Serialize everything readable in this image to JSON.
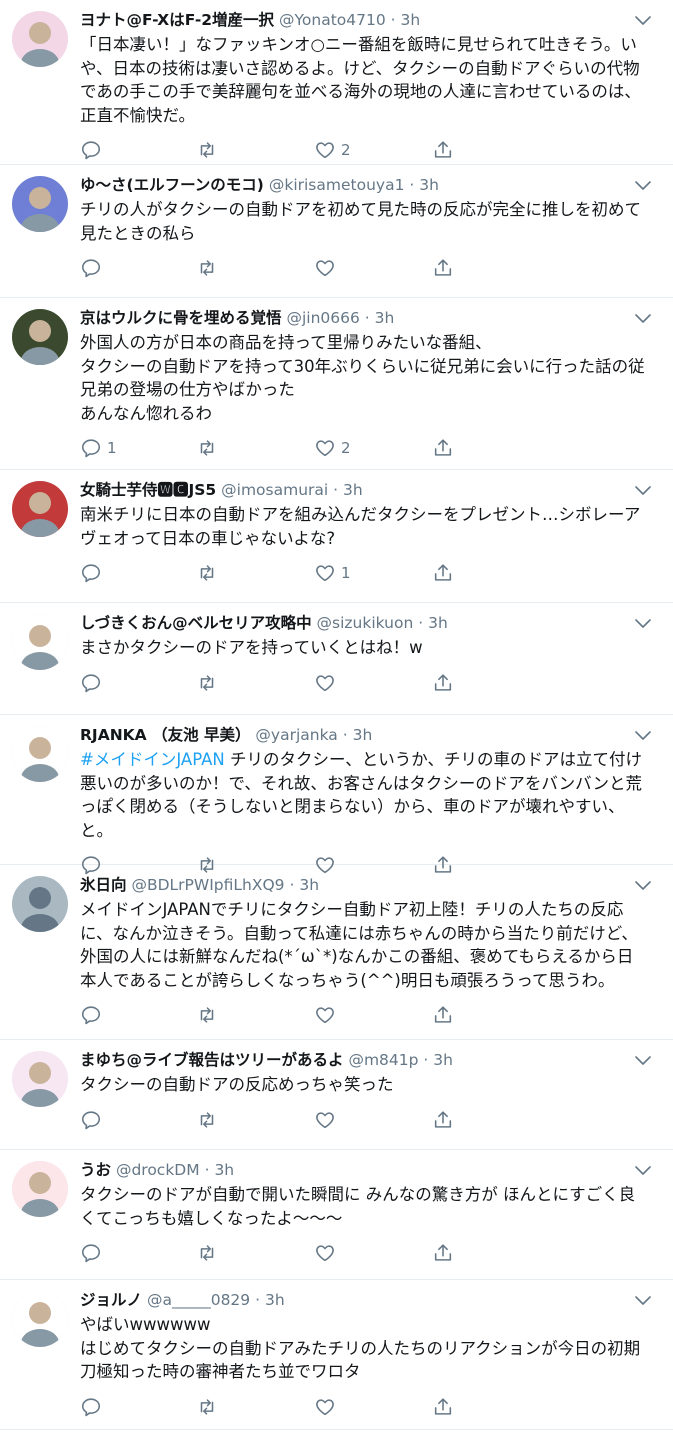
{
  "tweets": [
    {
      "name": "ヨナト@F-XはF-2増産一択",
      "handle": "@Yonato4710",
      "time": "3h",
      "text": "「日本凄い！」なファッキンオ○ニー番組を飯時に見せられて吐きそう。いや、日本の技術は凄いさ認めるよ。けど、タクシーの自動ドアぐらいの代物であの手この手で美辞麗句を並べる海外の現地の人達に言わせているのは、正直不愉快だ。",
      "hashtag": "",
      "reply_count": "",
      "like_count": "2",
      "avatar_color": "#f4d7e6"
    },
    {
      "name": "ゆ〜さ(エルフーンのモコ)",
      "handle": "@kirisametouya1",
      "time": "3h",
      "text": "チリの人がタクシーの自動ドアを初めて見た時の反応が完全に推しを初めて見たときの私ら",
      "hashtag": "",
      "reply_count": "",
      "like_count": "",
      "avatar_color": "#6f7fd6"
    },
    {
      "name": "京はウルクに骨を埋める覚悟",
      "handle": "@jin0666",
      "time": "3h",
      "text": "外国人の方が日本の商品を持って里帰りみたいな番組、\nタクシーの自動ドアを持って30年ぶりくらいに従兄弟に会いに行った話の従兄弟の登場の仕方やばかった\nあんなん惚れるわ",
      "hashtag": "",
      "reply_count": "1",
      "like_count": "2",
      "avatar_color": "#3b4a2e"
    },
    {
      "name": "女騎士芋侍🆆🅲JS5",
      "handle": "@imosamurai",
      "time": "3h",
      "text": "南米チリに日本の自動ドアを組み込んだタクシーをプレゼント…シボレーアヴェオって日本の車じゃないよな?",
      "hashtag": "",
      "reply_count": "",
      "like_count": "1",
      "avatar_color": "#c23a3a"
    },
    {
      "name": "しづきくおん@ベルセリア攻略中",
      "handle": "@sizukikuon",
      "time": "3h",
      "text": "まさかタクシーのドアを持っていくとはね！w",
      "hashtag": "",
      "reply_count": "",
      "like_count": "",
      "avatar_color": "#ffffff"
    },
    {
      "name": "RJANKA （友池 早美）",
      "handle": "@yarjanka",
      "time": "3h",
      "text": " チリのタクシー、というか、チリの車のドアは立て付け悪いのが多いのか！で、それ故、お客さんはタクシーのドアをバンバンと荒っぽく閉める（そうしないと閉まらない）から、車のドアが壊れやすい、と。",
      "hashtag": "#メイドインJAPAN",
      "reply_count": "",
      "like_count": "",
      "avatar_color": "#ffffff"
    },
    {
      "name": "氷日向",
      "handle": "@BDLrPWIpfiLhXQ9",
      "time": "3h",
      "text": "メイドインJAPANでチリにタクシー自動ドア初上陸！チリの人たちの反応に、なんか泣きそう。自動って私達には赤ちゃんの時から当たり前だけど、外国の人には新鮮なんだね(*´ω`*)なんかこの番組、褒めてもらえるから日本人であることが誇らしくなっちゃう(^^)明日も頑張ろうって思うわ。",
      "hashtag": "",
      "reply_count": "",
      "like_count": "",
      "avatar_color": "#aab8c2"
    },
    {
      "name": "まゆち@ライブ報告はツリーがあるよ",
      "handle": "@m841p",
      "time": "3h",
      "text": "タクシーの自動ドアの反応めっちゃ笑った",
      "hashtag": "",
      "reply_count": "",
      "like_count": "",
      "avatar_color": "#f7e7f3"
    },
    {
      "name": "うお",
      "handle": "@drockDM",
      "time": "3h",
      "text": "タクシーのドアが自動で開いた瞬間に みんなの驚き方が ほんとにすごく良くてこっちも嬉しくなったよ〜〜〜",
      "hashtag": "",
      "reply_count": "",
      "like_count": "",
      "avatar_color": "#fde6ea"
    },
    {
      "name": "ジョルノ",
      "handle": "@a_____0829",
      "time": "3h",
      "text": "やばいwwwwww\nはじめてタクシーの自動ドアみたチリの人たちのリアクションが今日の初期刀極知った時の審神者たち並でワロタ",
      "hashtag": "",
      "reply_count": "",
      "like_count": "",
      "avatar_color": "#ffffff"
    }
  ],
  "separator": "·"
}
